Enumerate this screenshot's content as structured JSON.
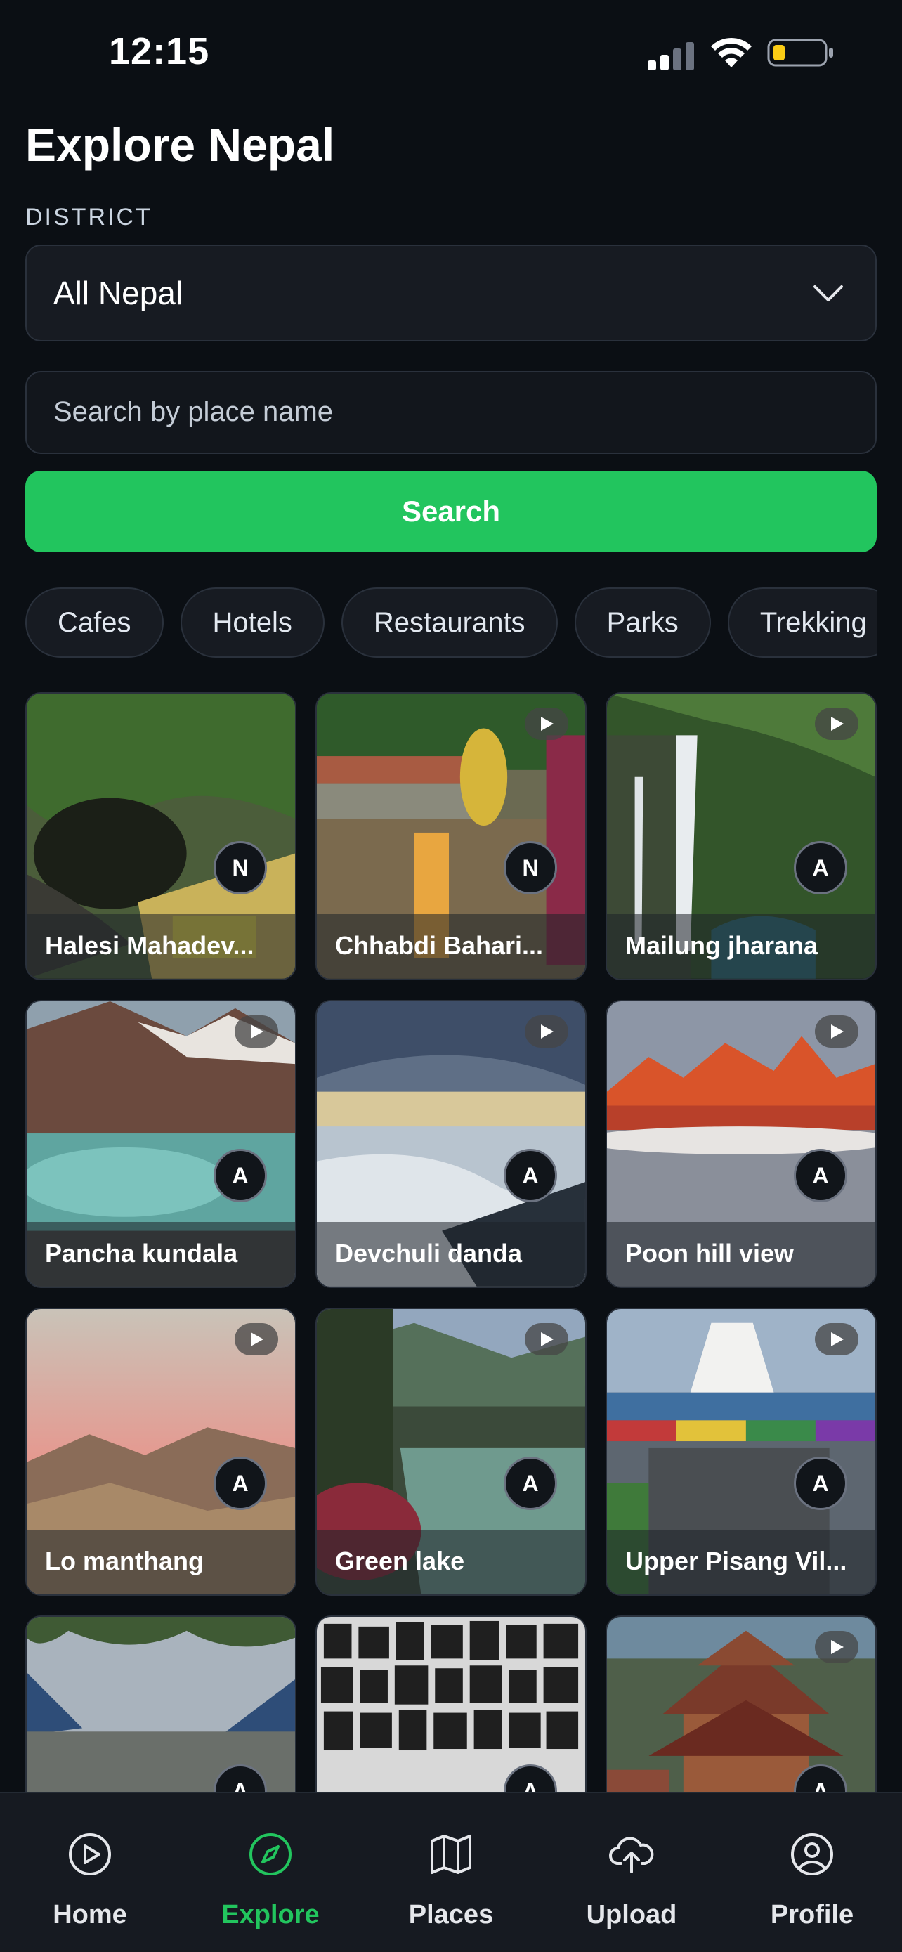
{
  "status_bar": {
    "time": "12:15"
  },
  "header": {
    "title": "Explore Nepal"
  },
  "district": {
    "label": "DISTRICT",
    "selected": "All Nepal"
  },
  "search": {
    "placeholder": "Search by place name",
    "button_label": "Search"
  },
  "categories": [
    "Cafes",
    "Hotels",
    "Restaurants",
    "Parks",
    "Trekking"
  ],
  "places": [
    {
      "title": "Halesi Mahadev...",
      "badge": "N",
      "video": false
    },
    {
      "title": "Chhabdi Bahari...",
      "badge": "N",
      "video": true
    },
    {
      "title": "Mailung jharana",
      "badge": "A",
      "video": true
    },
    {
      "title": "Pancha kundala",
      "badge": "A",
      "video": true
    },
    {
      "title": "Devchuli danda",
      "badge": "A",
      "video": true
    },
    {
      "title": "Poon hill view",
      "badge": "A",
      "video": true
    },
    {
      "title": "Lo manthang",
      "badge": "A",
      "video": true
    },
    {
      "title": "Green lake",
      "badge": "A",
      "video": true
    },
    {
      "title": "Upper Pisang Vil...",
      "badge": "A",
      "video": true
    },
    {
      "title": "",
      "badge": "A",
      "video": false
    },
    {
      "title": "",
      "badge": "A",
      "video": false
    },
    {
      "title": "",
      "badge": "A",
      "video": true
    }
  ],
  "nav": [
    {
      "label": "Home",
      "icon": "play-circle-icon",
      "active": false
    },
    {
      "label": "Explore",
      "icon": "compass-icon",
      "active": true
    },
    {
      "label": "Places",
      "icon": "map-icon",
      "active": false
    },
    {
      "label": "Upload",
      "icon": "cloud-upload-icon",
      "active": false
    },
    {
      "label": "Profile",
      "icon": "user-circle-icon",
      "active": false
    }
  ],
  "colors": {
    "accent": "#22c55e",
    "background": "#0b0f14",
    "surface": "#171b22"
  }
}
